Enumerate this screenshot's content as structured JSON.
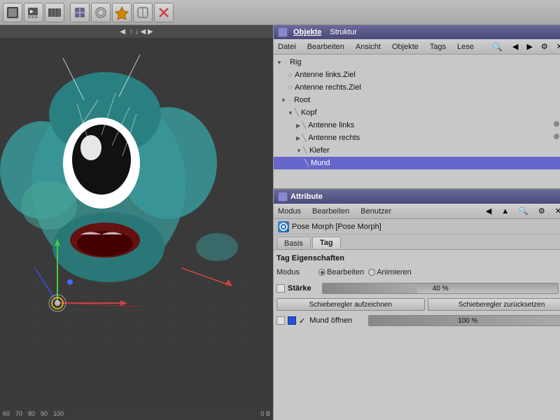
{
  "toolbar": {
    "buttons": [
      "⬛",
      "🎬",
      "🎞️",
      "📦",
      "🔄",
      "⚙️",
      "🔮",
      "⭐",
      "❌"
    ]
  },
  "viewport": {
    "ticks": [
      "60",
      "70",
      "80",
      "90",
      "100"
    ],
    "bottom_right": "0 B"
  },
  "obj_manager": {
    "title_tab1": "Objekte",
    "title_tab2": "Struktur",
    "menus": [
      "Datei",
      "Bearbeiten",
      "Ansicht",
      "Objekte",
      "Tags",
      "Lese"
    ],
    "tree": [
      {
        "label": "Rig",
        "indent": 0,
        "has_arrow": true,
        "expanded": true,
        "type": "null"
      },
      {
        "label": "Antenne links.Ziel",
        "indent": 2,
        "has_arrow": false,
        "type": "bone"
      },
      {
        "label": "Antenne rechts.Ziel",
        "indent": 2,
        "has_arrow": false,
        "type": "bone"
      },
      {
        "label": "Root",
        "indent": 1,
        "has_arrow": true,
        "expanded": true,
        "type": "null"
      },
      {
        "label": "Kopf",
        "indent": 2,
        "has_arrow": true,
        "expanded": true,
        "type": "mesh",
        "selected": false
      },
      {
        "label": "Antenne links",
        "indent": 3,
        "has_arrow": true,
        "expanded": false,
        "type": "mesh"
      },
      {
        "label": "Antenne rechts",
        "indent": 3,
        "has_arrow": true,
        "expanded": false,
        "type": "mesh"
      },
      {
        "label": "Kiefer",
        "indent": 3,
        "has_arrow": true,
        "expanded": true,
        "type": "mesh"
      },
      {
        "label": "Mund",
        "indent": 4,
        "has_arrow": false,
        "type": "mesh",
        "selected": true
      }
    ]
  },
  "attr_panel": {
    "title": "Attribute",
    "menus": [
      "Modus",
      "Bearbeiten",
      "Benutzer"
    ],
    "pose_morph_label": "Pose Morph [Pose Morph]",
    "tabs": [
      "Basis",
      "Tag"
    ],
    "active_tab": "Tag",
    "section_title": "Tag Eigenschaften",
    "modus_label": "Modus",
    "radio_options": [
      "Bearbeiten",
      "Animieren"
    ],
    "active_radio": "Bearbeiten",
    "starke_label": "Stärke",
    "starke_value": "40 %",
    "starke_percent": 40,
    "btn1": "Schieberegler aufzeichnen",
    "btn2": "Schieberegler zurücksetzen",
    "mund_label": "Mund öffnen",
    "mund_value": "100 %",
    "mund_percent": 100
  }
}
